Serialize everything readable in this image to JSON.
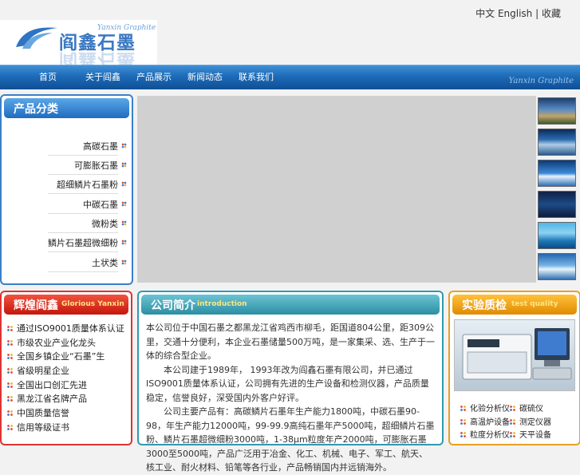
{
  "header": {
    "logo_cn": "阎鑫石墨",
    "logo_en": "Yanxin Graphite",
    "lang": {
      "cn": "中文",
      "en": "English",
      "sep": "|",
      "other": "收藏"
    }
  },
  "nav": {
    "items": [
      "首页",
      "关于阎鑫",
      "产品展示",
      "新闻动态",
      "联系我们"
    ],
    "brand": "Yanxin Graphite"
  },
  "categories": {
    "title": "产品分类",
    "items": [
      "高碳石墨",
      "可膨胀石墨",
      "超细鳞片石墨粉",
      "中碳石墨",
      "微粉类",
      "鳞片石墨超微细粉",
      "土状类"
    ]
  },
  "glory": {
    "title_cn": "辉煌阎鑫",
    "title_en": "Glorious Yanxin",
    "items": [
      "通过ISO9001质量体系认证",
      "市级农业产业化龙头",
      "全国乡镇企业“石墨”生",
      "省级明星企业",
      "全国出口创汇先进",
      "黑龙江省名牌产品",
      "中国质量信誉",
      "信用等级证书"
    ]
  },
  "intro": {
    "title_cn": "公司简介",
    "title_en": "introduction",
    "paragraphs": [
      "本公司位于中国石墨之都黑龙江省鸡西市柳毛，距国道804公里，距309公里，交通十分便利，本企业石墨储量500万吨，是一家集采、选、生产于一体的综合型企业。",
      "本公司建于1989年， 1993年改为阎鑫石墨有限公司，并已通过ISO9001质量体系认证，公司拥有先进的生产设备和检测仪器，产品质量稳定，信誉良好，深受国内外客户好评。",
      "公司主要产品有：高碳鳞片石墨年生产能力1800吨，中碳石墨90-98，年生产能力12000吨，99-99.9高纯石墨年产5000吨，超细鳞片石墨粉、鳞片石墨超微细粉3000吨，1-38μm粒度年产2000吨，可膨胀石墨3000至5000吨，产品广泛用于冶金、化工、机械、电子、军工、航天、核工业、耐火材料、铅笔等各行业，产品畅销国内并远销海外。"
    ]
  },
  "quality": {
    "title_cn": "实验质检",
    "title_en": "test quality",
    "items": [
      "化验分析仪",
      "碳硫仪",
      "高温炉设备",
      "测定仪器",
      "粒度分析仪",
      "天平设备"
    ]
  },
  "thumbnails": [
    "thumbnail-1",
    "thumbnail-2",
    "thumbnail-3",
    "thumbnail-4",
    "thumbnail-5",
    "thumbnail-6"
  ],
  "colors": {
    "nav": "#1d6bb8",
    "cat_title": "#2f7fcf",
    "glory_title": "#d8261a",
    "intro_title": "#2b8ea2",
    "quality_title": "#e8920a"
  }
}
